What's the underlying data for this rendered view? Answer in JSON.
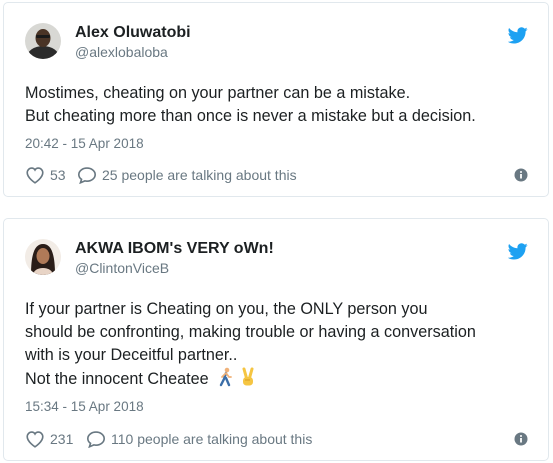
{
  "tweets": [
    {
      "author": {
        "display_name": "Alex Oluwatobi",
        "handle": "@alexlobaloba"
      },
      "text_lines": [
        "Mostimes, cheating on your partner can be a mistake.",
        "But cheating more than once is never a mistake but a decision."
      ],
      "timestamp": "20:42 - 15 Apr 2018",
      "likes": "53",
      "talking": "25 people are talking about this"
    },
    {
      "author": {
        "display_name": "AKWA IBOM's VERY oWn!",
        "handle": "@ClintonViceB"
      },
      "text_lines": [
        "If your partner is Cheating on you, the ONLY person you",
        "should be confronting, making trouble or having a conversation",
        "with is your Deceitful partner..",
        "Not the innocent Cheatee"
      ],
      "emojis": [
        "walking-person-emoji",
        "victory-hand-emoji"
      ],
      "timestamp": "15:34 - 15 Apr 2018",
      "likes": "231",
      "talking": "110 people are talking about this"
    }
  ],
  "colors": {
    "brand_blue": "#1da1f2",
    "text": "#1c2022",
    "muted": "#697882",
    "border": "#e1e8ed"
  },
  "icons": [
    "twitter-bird-icon",
    "heart-icon",
    "comment-icon",
    "info-icon"
  ]
}
